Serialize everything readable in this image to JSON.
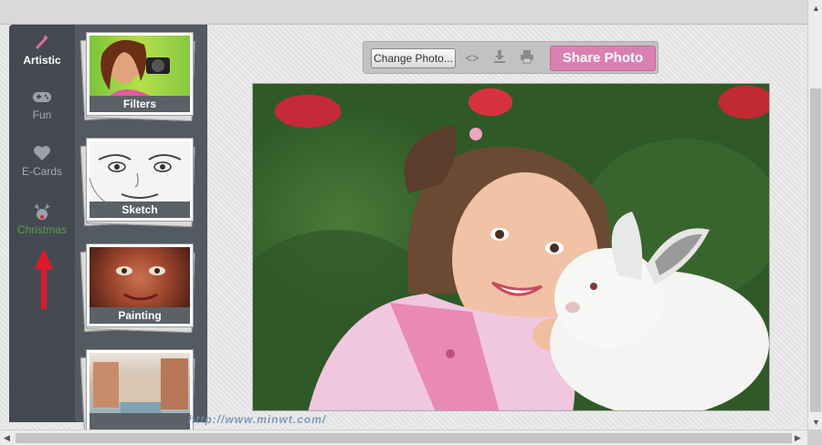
{
  "nav": {
    "items": [
      {
        "label": "Artistic",
        "icon": "magic-wand-icon"
      },
      {
        "label": "Fun",
        "icon": "gamepad-icon"
      },
      {
        "label": "E-Cards",
        "icon": "heart-icon"
      },
      {
        "label": "Christmas",
        "icon": "reindeer-icon"
      }
    ]
  },
  "thumbs": [
    {
      "label": "Filters"
    },
    {
      "label": "Sketch"
    },
    {
      "label": "Painting"
    },
    {
      "label": ""
    }
  ],
  "toolbar": {
    "change_label": "Change Photo...",
    "share_label": "Share Photo"
  },
  "watermark": "http://www.minwt.com/",
  "colors": {
    "share": "#d981b3",
    "nav_bg": "#454a52",
    "christmas_label": "#5a9a4a",
    "arrow": "#e0192a"
  }
}
